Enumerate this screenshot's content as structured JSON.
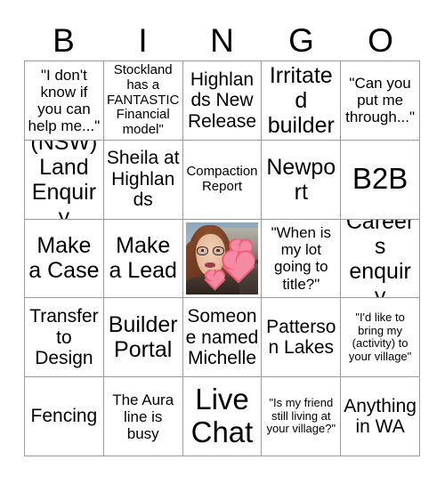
{
  "header": {
    "letters": [
      "B",
      "I",
      "N",
      "G",
      "O"
    ]
  },
  "colors": {
    "background": "#ffffff",
    "text": "#000000",
    "grid_line": "#9a9a9a",
    "heart_fill": "#f58ba3",
    "heart_outline": "#ef5c78"
  },
  "grid": {
    "columns": 5,
    "rows": 5,
    "cells": [
      {
        "text": "\"I don't know if you can help me...\"",
        "size": "md",
        "type": "text"
      },
      {
        "text": "Stockland has a FANTASTIC Financial model\"",
        "size": "sm",
        "type": "text"
      },
      {
        "text": "Highlands New Release",
        "size": "lg",
        "type": "text"
      },
      {
        "text": "Irritated builder",
        "size": "xl",
        "type": "text"
      },
      {
        "text": "\"Can you put me through...\"",
        "size": "md",
        "type": "text"
      },
      {
        "text": "(NSW) Land Enquiry",
        "size": "xl",
        "type": "text"
      },
      {
        "text": "Sheila at Highlands",
        "size": "lg",
        "type": "text"
      },
      {
        "text": "Compaction Report",
        "size": "sm",
        "type": "text"
      },
      {
        "text": "Newport",
        "size": "xl",
        "type": "text"
      },
      {
        "text": "B2B",
        "size": "xxl",
        "type": "text"
      },
      {
        "text": "Make a Case",
        "size": "xl",
        "type": "text"
      },
      {
        "text": "Make a Lead",
        "size": "xl",
        "type": "text"
      },
      {
        "text": "",
        "size": "md",
        "type": "photo",
        "photo_alt": "selfie-photo-of-woman-with-glasses-and-heart-stickers"
      },
      {
        "text": "\"When is my lot going to title?\"",
        "size": "md",
        "type": "text"
      },
      {
        "text": "Careers enquiry",
        "size": "xl",
        "type": "text"
      },
      {
        "text": "Transfer to Design",
        "size": "lg",
        "type": "text"
      },
      {
        "text": "Builder Portal",
        "size": "xl",
        "type": "text"
      },
      {
        "text": "Someone named Michelle",
        "size": "lg",
        "type": "text"
      },
      {
        "text": "Patterson Lakes",
        "size": "lg",
        "type": "text"
      },
      {
        "text": "\"I'd like to bring my (activity) to your village\"",
        "size": "xs",
        "type": "text"
      },
      {
        "text": "Fencing",
        "size": "lg",
        "type": "text"
      },
      {
        "text": "The Aura line is busy",
        "size": "md",
        "type": "text"
      },
      {
        "text": "Live Chat",
        "size": "xxl",
        "type": "text"
      },
      {
        "text": "\"Is my friend still living at your village?\"",
        "size": "xs",
        "type": "text"
      },
      {
        "text": "Anything in WA",
        "size": "lg",
        "type": "text"
      }
    ]
  }
}
